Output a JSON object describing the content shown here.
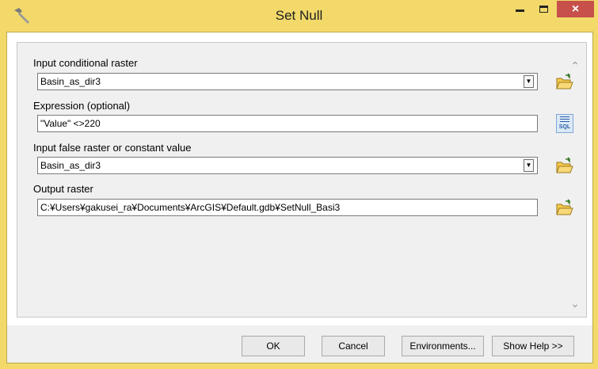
{
  "window": {
    "title": "Set Null",
    "close_glyph": "×",
    "colors": {
      "frame": "#f2d96a",
      "close": "#c7504b"
    },
    "icons": [
      "hammer-icon",
      "minimize-icon",
      "maximize-icon",
      "close-icon"
    ]
  },
  "params": {
    "input_conditional_raster": {
      "label": "Input conditional raster",
      "value": "Basin_as_dir3"
    },
    "expression": {
      "label": "Expression (optional)",
      "value": "\"Value\" <>220"
    },
    "input_false_raster": {
      "label": "Input false raster or constant value",
      "value": "Basin_as_dir3"
    },
    "output_raster": {
      "label": "Output raster",
      "value": "C:¥Users¥gakusei_ra¥Documents¥ArcGIS¥Default.gdb¥SetNull_Basi3"
    }
  },
  "sql_button": {
    "label": "SQL"
  },
  "buttons": {
    "ok": "OK",
    "cancel": "Cancel",
    "environments": "Environments...",
    "show_help": "Show Help >>"
  }
}
